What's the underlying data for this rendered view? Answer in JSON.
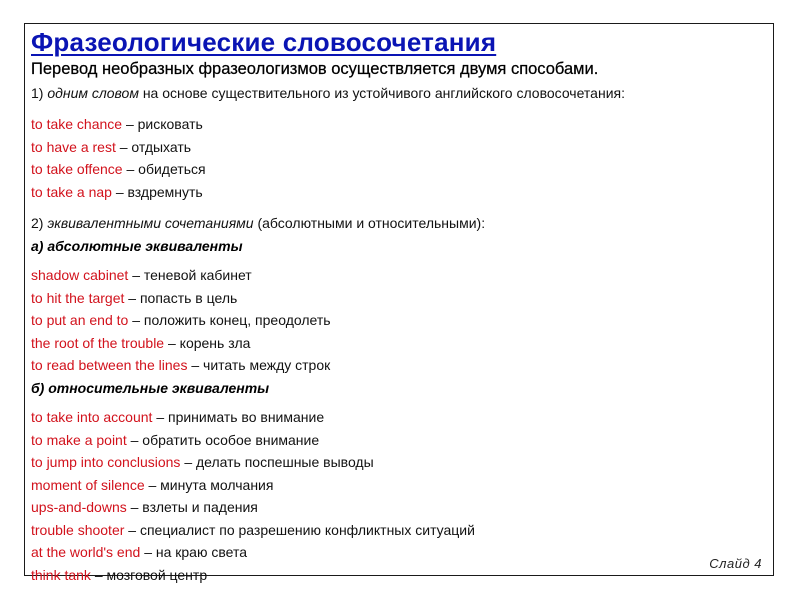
{
  "slide": {
    "title": "Фразеологические словосочетания",
    "subtitle": "Перевод необразных фразеологизмов осуществляется двумя способами.",
    "method1": {
      "number": "1)",
      "emphasis": "одним словом",
      "rest": "на основе существительного из устойчивого английского словосочетания:"
    },
    "method1_items": [
      {
        "en": "to take chance",
        "ru": "– рисковать"
      },
      {
        "en": "to have a rest",
        "ru": "– отдыхать"
      },
      {
        "en": "to take offence",
        "ru": "– обидеться"
      },
      {
        "en": "to take a nap",
        "ru": "– вздремнуть"
      }
    ],
    "method2": {
      "number": "2)",
      "emphasis": "эквивалентными сочетаниями",
      "rest": "(абсолютными и относительными):"
    },
    "absolute_heading": "а) абсолютные эквиваленты",
    "absolute_items": [
      {
        "en": "shadow cabinet",
        "ru": "– теневой кабинет"
      },
      {
        "en": "to hit the target",
        "ru": "– попасть в цель"
      },
      {
        "en": "to put an end to",
        "ru": "– положить конец, преодолеть"
      },
      {
        "en": "the root of the trouble",
        "ru": "– корень зла"
      },
      {
        "en": "to read between the lines",
        "ru": "– читать между строк"
      }
    ],
    "relative_heading": "б) относительные эквиваленты",
    "relative_items": [
      {
        "en": "to take into account",
        "ru": "– принимать во внимание"
      },
      {
        "en": "to make a point",
        "ru": "– обратить особое внимание"
      },
      {
        "en": "to jump into conclusions",
        "ru": "– делать поспешные выводы"
      },
      {
        "en": "moment of silence",
        "ru": "– минута молчания"
      },
      {
        "en": "ups-and-downs",
        "ru": "– взлеты и падения"
      },
      {
        "en": "trouble shooter",
        "ru": "– специалист по разрешению конфликтных ситуаций"
      },
      {
        "en": "at the world's end",
        "ru": "– на краю света"
      },
      {
        "en": "think tank",
        "ru": "– мозговой центр"
      }
    ],
    "slide_number": "Слайд 4",
    "colors": {
      "title": "#0a14b4",
      "english_phrase": "#d2121c",
      "text": "#111111",
      "frame": "#1a1a1a"
    }
  }
}
